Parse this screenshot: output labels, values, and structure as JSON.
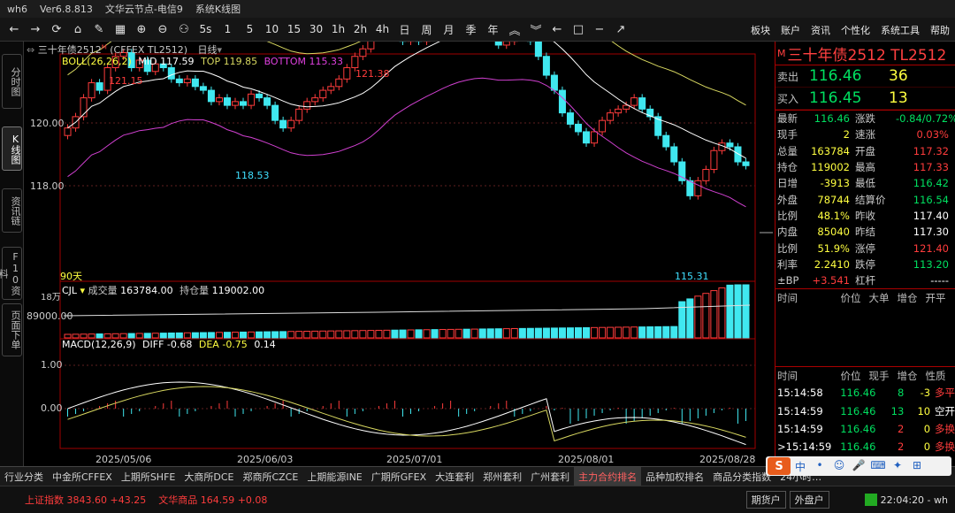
{
  "titlebar": {
    "app": "wh6",
    "version": "Ver6.8.813",
    "node": "文华云节点-电信9",
    "mode": "系统K线图"
  },
  "toolbar": {
    "icons": [
      "back-arrow-icon",
      "forward-arrow-icon",
      "refresh-icon",
      "home-icon",
      "draw-line-icon",
      "ruler-icon",
      "zoom-in-icon",
      "zoom-out-icon",
      "chart-type-icon"
    ],
    "periods": [
      "5s",
      "1",
      "5",
      "10",
      "15",
      "30",
      "1h",
      "2h",
      "4h",
      "日",
      "周",
      "月",
      "季",
      "年"
    ],
    "right_menu": [
      "板块",
      "账户",
      "资讯",
      "个性化",
      "系统工具",
      "帮助"
    ]
  },
  "left_tabs": [
    "分时图",
    "K线图",
    "资讯链",
    "F10资料",
    "页面下单"
  ],
  "chart": {
    "header": {
      "name": "三十年债2512",
      "mark": "M",
      "code": "(CFFEX TL2512)",
      "period": "日线",
      "dropdown_glyph": "▾"
    },
    "boll": {
      "label": "BOLL(26,26,2)",
      "mid_label": "MID",
      "mid": "117.59",
      "top_label": "TOP",
      "top": "119.85",
      "bottom_label": "BOTTOM",
      "bottom": "115.33"
    },
    "price_labels": {
      "y120": "120.00",
      "y118": "118.00"
    },
    "annotations": {
      "h1": "121.15",
      "h2": "121.38",
      "low1": "118.53",
      "low2": "115.31",
      "days": "90天"
    },
    "volume": {
      "label": "CJL",
      "vol_label": "成交量",
      "vol": "163784.00",
      "oi_label": "持仓量",
      "oi": "119002.00",
      "axis_top": "18万",
      "axis_mid": "89000.00"
    },
    "macd": {
      "label": "MACD(12,26,9)",
      "diff_label": "DIFF",
      "diff": "-0.68",
      "dea_label": "DEA",
      "dea": "-0.75",
      "macd": "0.14",
      "axis_top": "1.00",
      "axis_mid": "0.00"
    },
    "dates": [
      "2025/05/06",
      "2025/06/03",
      "2025/07/01",
      "2025/08/01",
      "2025/08/28"
    ]
  },
  "quote": {
    "title": "三十年债2512  TL2512",
    "title_mark": "M",
    "ask_label": "卖出",
    "ask": "116.46",
    "ask_vol": "36",
    "bid_label": "买入",
    "bid": "116.45",
    "bid_vol": "13",
    "rows": [
      {
        "k1": "最新",
        "v1": "116.46",
        "c1": "green",
        "k2": "涨跌",
        "v2": "-0.84/0.72%",
        "c2": "green"
      },
      {
        "k1": "现手",
        "v1": "2",
        "c1": "yellow",
        "k2": "速涨",
        "v2": "0.03%",
        "c2": "red"
      },
      {
        "k1": "总量",
        "v1": "163784",
        "c1": "yellow",
        "k2": "开盘",
        "v2": "117.32",
        "c2": "red"
      },
      {
        "k1": "持仓",
        "v1": "119002",
        "c1": "yellow",
        "k2": "最高",
        "v2": "117.33",
        "c2": "red"
      },
      {
        "k1": "日增",
        "v1": "-3913",
        "c1": "yellow",
        "k2": "最低",
        "v2": "116.42",
        "c2": "green"
      },
      {
        "k1": "外盘",
        "v1": "78744",
        "c1": "yellow",
        "k2": "结算价",
        "v2": "116.54",
        "c2": "green"
      },
      {
        "k1": "比例",
        "v1": "48.1%",
        "c1": "yellow",
        "k2": "昨收",
        "v2": "117.40",
        "c2": "white"
      },
      {
        "k1": "内盘",
        "v1": "85040",
        "c1": "yellow",
        "k2": "昨结",
        "v2": "117.30",
        "c2": "white"
      },
      {
        "k1": "比例",
        "v1": "51.9%",
        "c1": "yellow",
        "k2": "涨停",
        "v2": "121.40",
        "c2": "red"
      },
      {
        "k1": "利率",
        "v1": "2.2410",
        "c1": "yellow",
        "k2": "跌停",
        "v2": "113.20",
        "c2": "green"
      },
      {
        "k1": "±BP",
        "v1": "+3.541",
        "c1": "red",
        "k2": "杠杆",
        "v2": "-----",
        "c2": "white"
      }
    ],
    "tick_header": [
      "时间",
      "价位",
      "大单",
      "增仓",
      "开平"
    ],
    "tick_header2": [
      "时间",
      "价位",
      "现手",
      "增仓",
      "性质"
    ],
    "ticks": [
      {
        "t": "15:14:58",
        "p": "116.46",
        "v": "8",
        "c": "-3",
        "n": "多平",
        "vc": "green",
        "cc": "yellow",
        "nc": "red"
      },
      {
        "t": "15:14:59",
        "p": "116.46",
        "v": "13",
        "c": "10",
        "n": "空开",
        "vc": "green",
        "cc": "yellow",
        "nc": "white"
      },
      {
        "t": "15:14:59",
        "p": "116.46",
        "v": "2",
        "c": "0",
        "n": "多换",
        "vc": "red",
        "cc": "yellow",
        "nc": "red"
      },
      {
        "t": ">15:14:59",
        "p": "116.46",
        "v": "2",
        "c": "0",
        "n": "多换",
        "vc": "red",
        "cc": "yellow",
        "nc": "red"
      }
    ]
  },
  "bottom_tabs": [
    "行业分类",
    "中金所CFFEX",
    "上期所SHFE",
    "大商所DCE",
    "郑商所CZCE",
    "上期能源INE",
    "广期所GFEX",
    "大连套利",
    "郑州套利",
    "广州套利",
    "主力合约排名",
    "品种加权排名",
    "商品分类指数",
    "24小时…"
  ],
  "bottom_active": 10,
  "status": {
    "idx1_name": "上证指数",
    "idx1": "3843.60",
    "idx1_chg": "+43.25",
    "idx2_name": "文华商品",
    "idx2": "164.59",
    "idx2_chg": "+0.08",
    "btn1": "期货户",
    "btn2": "外盘户",
    "time": "22:04:20 - wh"
  },
  "ime": {
    "logo": "S",
    "items": [
      "中",
      "•",
      "☺",
      "🎤",
      "⌨",
      "✦",
      "⊞"
    ]
  },
  "colors": {
    "up": "#ff3c3c",
    "down": "#40e8f0",
    "mid": "#ffffff",
    "top": "#d8d860",
    "bottom": "#d040d0",
    "bg": "#000000"
  }
}
